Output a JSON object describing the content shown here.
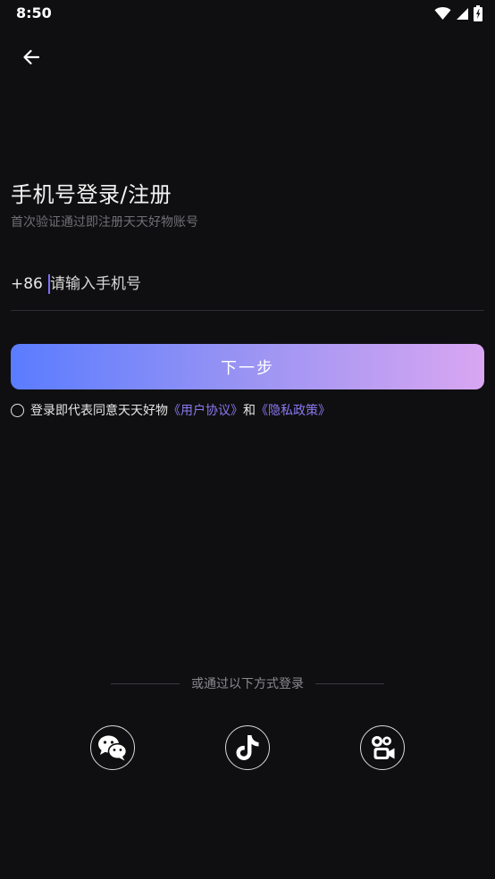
{
  "status_bar": {
    "time": "8:50",
    "icons": [
      "wifi-icon",
      "signal-icon",
      "battery-icon"
    ]
  },
  "header": {
    "back_icon": "arrow-left-icon"
  },
  "login": {
    "title": "手机号登录/注册",
    "subtitle": "首次验证通过即注册天天好物账号",
    "country_code": "+86",
    "phone_placeholder": "请输入手机号",
    "phone_value": "",
    "next_label": "下一步",
    "agreement": {
      "checked": false,
      "prefix": "登录即代表同意天天好物",
      "user_agreement": "《用户协议》",
      "conjunction": "和",
      "privacy_policy": "《隐私政策》"
    }
  },
  "alternative_login": {
    "divider_text": "或通过以下方式登录",
    "providers": [
      {
        "name": "wechat",
        "icon": "wechat-icon"
      },
      {
        "name": "douyin",
        "icon": "douyin-icon"
      },
      {
        "name": "kuaishou",
        "icon": "kuaishou-icon"
      }
    ]
  },
  "colors": {
    "background": "#0f0f11",
    "accent_link": "#8a78f0",
    "button_gradient_start": "#5a7cff",
    "button_gradient_end": "#d9a6f2"
  }
}
